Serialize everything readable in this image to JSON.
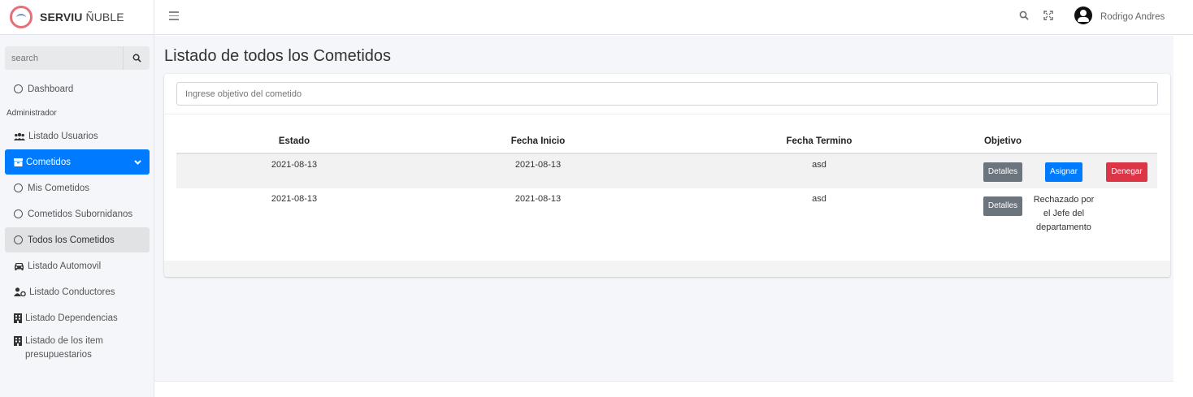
{
  "brand": {
    "name_bold": "SERVIU",
    "name_rest": "ÑUBLE"
  },
  "sidebar": {
    "search": {
      "placeholder": "search"
    },
    "items": [
      {
        "label": "Dashboard",
        "icon": "circle-icon"
      },
      {
        "header": "Administrador"
      },
      {
        "label": "Listado Usuarios",
        "icon": "users-icon"
      },
      {
        "label": "Cometidos",
        "icon": "folder-icon",
        "active": true
      },
      {
        "label": "Mis Cometidos",
        "icon": "circle-icon"
      },
      {
        "label": "Cometidos Subornidanos",
        "icon": "circle-icon"
      },
      {
        "label": "Todos los Cometidos",
        "icon": "circle-icon",
        "selected": true
      },
      {
        "label": "Listado Automovil",
        "icon": "car-icon"
      },
      {
        "label": "Listado Conductores",
        "icon": "driver-icon"
      },
      {
        "label": "Listado Dependencias",
        "icon": "building-icon"
      },
      {
        "label": "Listado de los item presupuestarios",
        "icon": "building-icon"
      }
    ]
  },
  "topbar": {
    "user_name": "Rodrigo Andres"
  },
  "main": {
    "title": "Listado de todos los Cometidos",
    "filter_placeholder": "Ingrese objetivo del cometido",
    "table": {
      "headers": [
        "Estado",
        "Fecha Inicio",
        "Fecha Termino",
        "Objetivo"
      ],
      "rows": [
        {
          "estado": "2021-08-13",
          "fecha_inicio": "2021-08-13",
          "fecha_termino": "asd",
          "btn_detalles": "Detalles",
          "btn_asignar": "Asignar",
          "btn_denegar": "Denegar"
        },
        {
          "estado": "2021-08-13",
          "fecha_inicio": "2021-08-13",
          "fecha_termino": "asd",
          "btn_detalles": "Detalles",
          "status": "Rechazado por el Jefe del departamento"
        }
      ]
    }
  },
  "colors": {
    "primary": "#007bff",
    "danger": "#dc3545",
    "secondary": "#6c757d"
  }
}
